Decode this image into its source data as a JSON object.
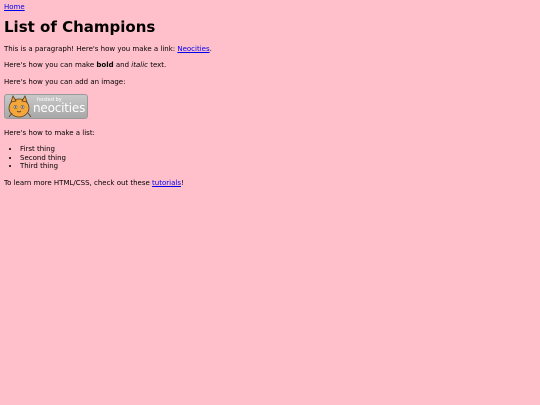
{
  "nav": {
    "home_label": "Home"
  },
  "page": {
    "title": "List of Champions",
    "p1_text": "This is a paragraph! Here's how you make a link: ",
    "p1_link": "Neocities",
    "p1_end": ".",
    "p2_start": "Here's how you can make ",
    "p2_bold": "bold",
    "p2_mid": " and ",
    "p2_italic": "italic",
    "p2_end": " text.",
    "p3_text": "Here's how you can add an image:",
    "badge": {
      "small_text": "hosted by",
      "big_text": "neocities"
    },
    "list_intro": "Here's how to make a list:",
    "list_items": [
      "First thing",
      "Second thing",
      "Third thing"
    ],
    "footer_start": "To learn more HTML/CSS, check out these ",
    "footer_link": "tutorials",
    "footer_end": "!"
  },
  "colors": {
    "background": "#ffc0cb",
    "link": "#0000ee"
  }
}
